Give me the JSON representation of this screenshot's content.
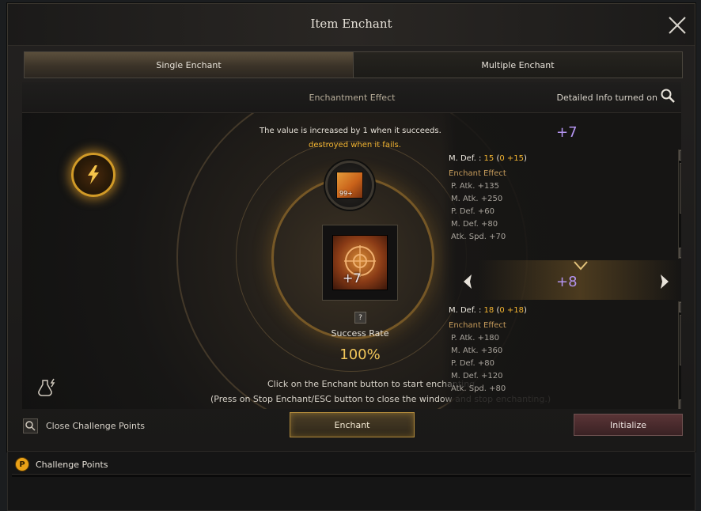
{
  "window": {
    "title": "Item Enchant"
  },
  "tabs": [
    {
      "label": "Single Enchant",
      "active": true
    },
    {
      "label": "Multiple Enchant",
      "active": false
    }
  ],
  "effect_header": {
    "title": "Enchantment Effect",
    "detail_info": "Detailed Info turned on"
  },
  "center": {
    "info_line1": "The value is increased by 1 when it succeeds.",
    "info_line2": "destroyed when it fails.",
    "scroll_count": "99+",
    "item_level": "+7",
    "help": "?",
    "success_label": "Success Rate",
    "success_value": "100%",
    "instruction1": "Click on the Enchant button to start enchanting.",
    "instruction2": "(Press on Stop Enchant/ESC button to close the window and stop enchanting.)"
  },
  "current": {
    "level": "+7",
    "main_label": "M. Def. : ",
    "main_value": "15",
    "main_open": " (",
    "main_base": "0",
    "main_bonus": " +15",
    "main_close": ")",
    "effect_title": "Enchant Effect",
    "effects": [
      "P. Atk. +135",
      "M. Atk. +250",
      "P. Def. +60",
      "M. Def. +80",
      "Atk. Spd. +70"
    ]
  },
  "next": {
    "level": "+8",
    "main_label": "M. Def. : ",
    "main_value": "18",
    "main_open": " (",
    "main_base": "0",
    "main_bonus": " +18",
    "main_close": ")",
    "effect_title": "Enchant Effect",
    "effects": [
      "P. Atk. +180",
      "M. Atk. +360",
      "P. Def. +80",
      "M. Def. +120",
      "Atk. Spd. +80"
    ]
  },
  "footer": {
    "close_cp_label": "Close Challenge Points",
    "enchant_label": "Enchant",
    "initialize_label": "Initialize"
  },
  "challenge_points": {
    "icon_letter": "P",
    "label": "Challenge Points"
  },
  "colors": {
    "gold": "#f2b431",
    "purple": "#b494f0",
    "stat_title": "#c49a5a"
  }
}
